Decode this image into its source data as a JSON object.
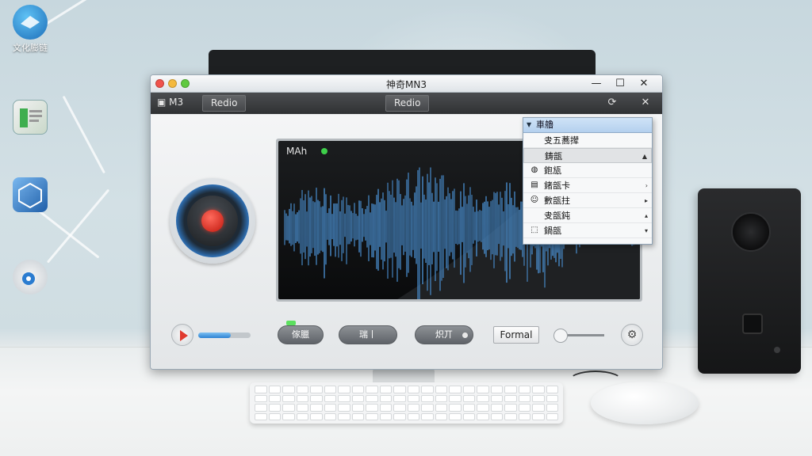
{
  "desktop": {
    "icons": [
      {
        "label": "文化膨链",
        "icon": "cloud-app-icon"
      },
      {
        "label": "",
        "icon": "book-icon"
      },
      {
        "label": "",
        "icon": "cube-icon"
      },
      {
        "label": "",
        "icon": "media-disc-icon"
      }
    ]
  },
  "window": {
    "title": "神奇MN3",
    "controls": {
      "minimize": "—",
      "maximize": "☐",
      "close": "✕"
    }
  },
  "toolbar": {
    "app_label": "M3",
    "tab_left": "Redio",
    "tab_center": "Redio",
    "refresh_icon": "⟳",
    "close_icon": "✕"
  },
  "waveform": {
    "label": "MAh",
    "colors": {
      "wave": "#4a8fd0",
      "background": "#0f1012"
    }
  },
  "dropdown": {
    "header": "車艪",
    "items": [
      {
        "label": "叏五蕎撵",
        "icon": "",
        "scroll": ""
      },
      {
        "label": "鋳瓿",
        "icon": "",
        "scroll": "▲",
        "selected": true
      },
      {
        "label": "鉋瓬",
        "icon": "◍",
        "scroll": ""
      },
      {
        "label": "鍺瓿卡",
        "icon": "▤",
        "scroll": "›"
      },
      {
        "label": "數瓿拄",
        "icon": "☺",
        "scroll": "▸"
      },
      {
        "label": "叏瓿鈍",
        "icon": "",
        "scroll": "▴"
      },
      {
        "label": "鍋瓿",
        "icon": "⬚",
        "scroll": "▾"
      }
    ]
  },
  "controls": {
    "volume_level": 0.62,
    "button_a": "傢臘",
    "button_b": "瑞丨",
    "button_c": "炽丌",
    "format_label": "Formal",
    "gear_icon": "⚙"
  },
  "colors": {
    "accent": "#2b82d3",
    "record": "#e0281c",
    "led": "#5be05e"
  }
}
